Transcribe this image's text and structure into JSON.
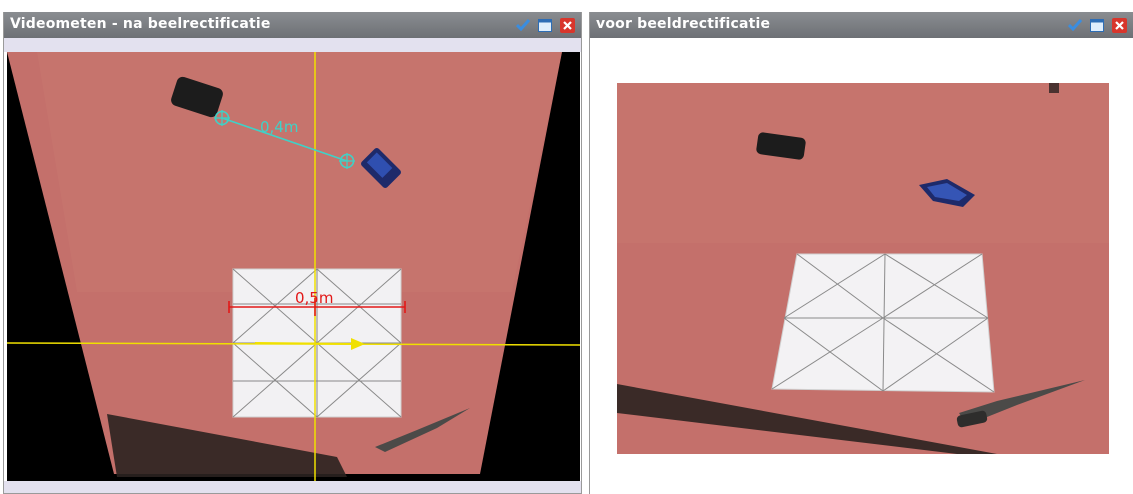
{
  "left_window": {
    "title": "Videometen - na beelrectificatie",
    "distance_label": "0,4m",
    "ref_label": "0,5m"
  },
  "right_window": {
    "title": "voor beeldrectificatie"
  },
  "icons": {
    "minimize": "checkmark-icon",
    "maximize": "window-icon",
    "close": "close-icon"
  },
  "colors": {
    "titlebar": "#7a7d82",
    "carpet": "#c4706b",
    "crosshair": "#f0e000",
    "measure_line": "#3fd1c7",
    "ref_line": "#e21818"
  }
}
